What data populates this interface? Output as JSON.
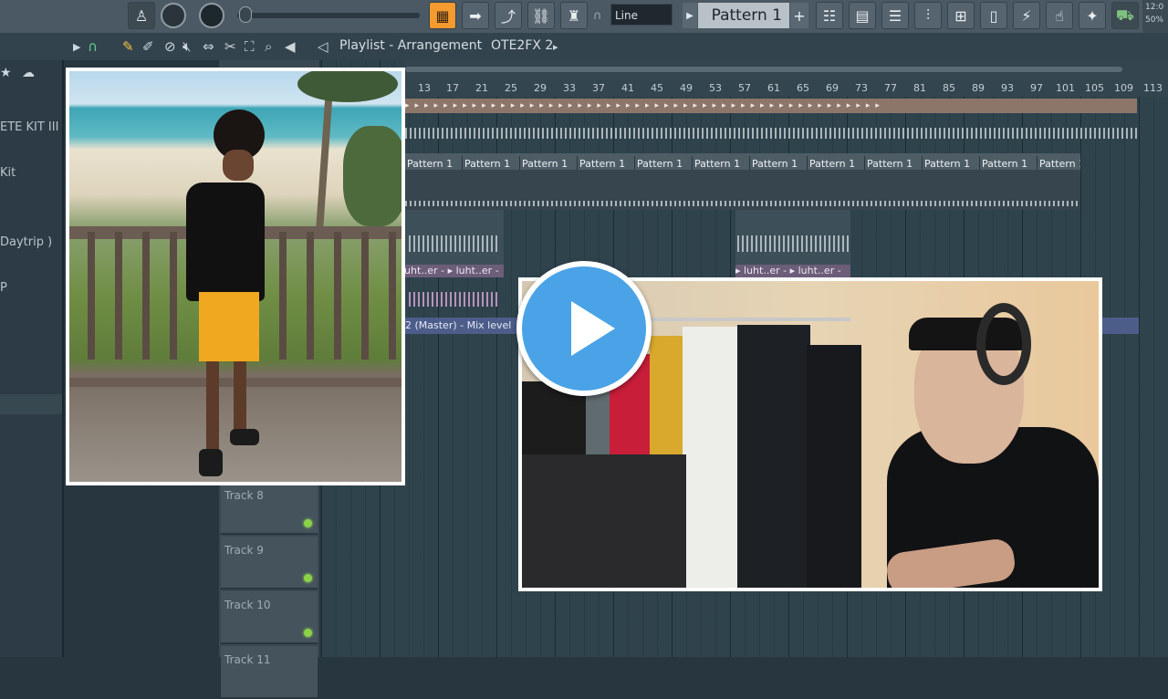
{
  "toolbar": {
    "line_mode": "Line",
    "pattern_name": "Pattern 1",
    "clock_time": "12:0",
    "clock_zoom": "50%"
  },
  "playlist": {
    "title": "Playlist - Arrangement",
    "current_pattern": "OTE2FX 2"
  },
  "sidebar": {
    "items": [
      "ETE KIT III",
      "Kit",
      "Daytrip )",
      "P"
    ]
  },
  "ruler": {
    "bars": [
      "13",
      "17",
      "21",
      "25",
      "29",
      "33",
      "37",
      "41",
      "45",
      "49",
      "53",
      "57",
      "61",
      "65",
      "69",
      "73",
      "77",
      "81",
      "85",
      "89",
      "93",
      "97",
      "101",
      "105",
      "109",
      "113"
    ]
  },
  "clips": {
    "pattern_label": "Pattern 1",
    "sample_label_a": "luht..er",
    "sample_label_b": "luht..er",
    "mix_label": "2 (Master) - Mix level"
  },
  "tracks": [
    {
      "name": "Track 8"
    },
    {
      "name": "Track 9"
    },
    {
      "name": "Track 10"
    },
    {
      "name": "Track 11"
    }
  ],
  "overlay": {
    "play_icon": "play-icon",
    "accent": "#4aa3e6"
  }
}
